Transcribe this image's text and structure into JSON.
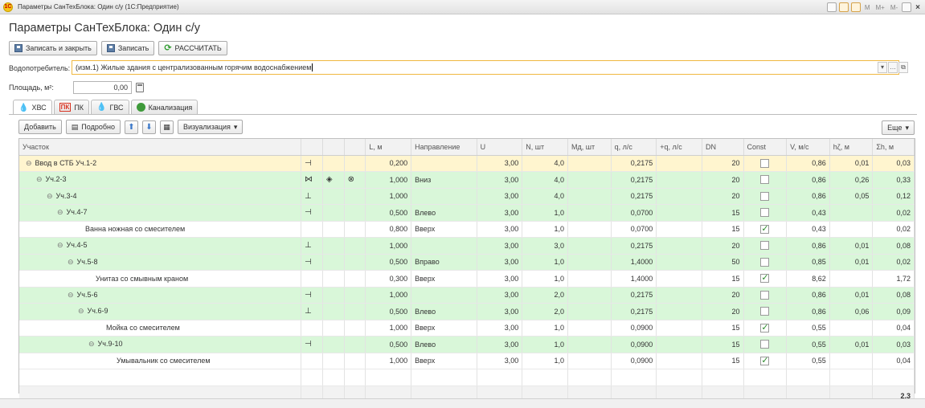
{
  "window": {
    "title": "Параметры СанТехБлока: Один с/у  (1С:Предприятие)",
    "logo": "1C",
    "controls": [
      "M",
      "M+",
      "M-"
    ],
    "close": "×"
  },
  "page_title": "Параметры СанТехБлока: Один с/у",
  "toolbar": {
    "save_close": "Записать и закрыть",
    "save": "Записать",
    "calculate": "РАССЧИТАТЬ"
  },
  "consumer": {
    "label": "Водопотребитель:",
    "value": "(изм.1) Жилые здания с централизованным горячим водоснабжением"
  },
  "area": {
    "label": "Площадь, м²:",
    "value": "0,00"
  },
  "tabs": [
    {
      "label": "ХВС",
      "active": true
    },
    {
      "label": "ПК",
      "badge": "ПК"
    },
    {
      "label": "ГВС"
    },
    {
      "label": "Канализация"
    }
  ],
  "table_toolbar": {
    "add": "Добавить",
    "details": "Подробно",
    "visualization": "Визуализация",
    "more": "Еще"
  },
  "columns": [
    "Участок",
    "",
    "",
    "",
    "L, м",
    "Направление",
    "U",
    "N, шт",
    "Mд, шт",
    "q, л/с",
    "+q, л/с",
    "DN",
    "Const",
    "V, м/с",
    "hζ, м",
    "Σh, м"
  ],
  "rows": [
    {
      "kind": "root",
      "indent": 0,
      "expand": "⊖",
      "name": "Ввод в СТБ Уч.1-2",
      "s1": "⊣",
      "s2": "",
      "s3": "",
      "L": "0,200",
      "dir": "",
      "U": "3,00",
      "N": "4,0",
      "Md": "",
      "q": "0,2175",
      "qplus": "",
      "DN": "20",
      "const": false,
      "V": "0,86",
      "hz": "0,01",
      "sh": "0,03"
    },
    {
      "kind": "seg",
      "indent": 1,
      "expand": "⊖",
      "name": "Уч.2-3",
      "s1": "⋈",
      "s2": "◈",
      "s3": "⊗",
      "L": "1,000",
      "dir": "Вниз",
      "U": "3,00",
      "N": "4,0",
      "Md": "",
      "q": "0,2175",
      "qplus": "",
      "DN": "20",
      "const": false,
      "V": "0,86",
      "hz": "0,26",
      "sh": "0,33"
    },
    {
      "kind": "seg",
      "indent": 2,
      "expand": "⊖",
      "name": "Уч.3-4",
      "s1": "⊥",
      "s2": "",
      "s3": "",
      "L": "1,000",
      "dir": "",
      "U": "3,00",
      "N": "4,0",
      "Md": "",
      "q": "0,2175",
      "qplus": "",
      "DN": "20",
      "const": false,
      "V": "0,86",
      "hz": "0,05",
      "sh": "0,12"
    },
    {
      "kind": "seg",
      "indent": 3,
      "expand": "⊖",
      "name": "Уч.4-7",
      "s1": "⊣",
      "s2": "",
      "s3": "",
      "L": "0,500",
      "dir": "Влево",
      "U": "3,00",
      "N": "1,0",
      "Md": "",
      "q": "0,0700",
      "qplus": "",
      "DN": "15",
      "const": false,
      "V": "0,43",
      "hz": "",
      "sh": "0,02"
    },
    {
      "kind": "dev",
      "indent": 4,
      "expand": "",
      "name": "Ванна ножная со смесителем",
      "s1": "",
      "s2": "",
      "s3": "",
      "L": "0,800",
      "dir": "Вверх",
      "U": "3,00",
      "N": "1,0",
      "Md": "",
      "q": "0,0700",
      "qplus": "",
      "DN": "15",
      "const": true,
      "V": "0,43",
      "hz": "",
      "sh": "0,02"
    },
    {
      "kind": "seg",
      "indent": 3,
      "expand": "⊖",
      "name": "Уч.4-5",
      "s1": "⊥",
      "s2": "",
      "s3": "",
      "L": "1,000",
      "dir": "",
      "U": "3,00",
      "N": "3,0",
      "Md": "",
      "q": "0,2175",
      "qplus": "",
      "DN": "20",
      "const": false,
      "V": "0,86",
      "hz": "0,01",
      "sh": "0,08"
    },
    {
      "kind": "seg",
      "indent": 4,
      "expand": "⊖",
      "name": "Уч.5-8",
      "s1": "⊣",
      "s2": "",
      "s3": "",
      "L": "0,500",
      "dir": "Вправо",
      "U": "3,00",
      "N": "1,0",
      "Md": "",
      "q": "1,4000",
      "qplus": "",
      "DN": "50",
      "const": false,
      "V": "0,85",
      "hz": "0,01",
      "sh": "0,02"
    },
    {
      "kind": "dev",
      "indent": 5,
      "expand": "",
      "name": "Унитаз со смывным краном",
      "s1": "",
      "s2": "",
      "s3": "",
      "L": "0,300",
      "dir": "Вверх",
      "U": "3,00",
      "N": "1,0",
      "Md": "",
      "q": "1,4000",
      "qplus": "",
      "DN": "15",
      "const": true,
      "V": "8,62",
      "hz": "",
      "sh": "1,72"
    },
    {
      "kind": "seg",
      "indent": 4,
      "expand": "⊖",
      "name": "Уч.5-6",
      "s1": "⊣",
      "s2": "",
      "s3": "",
      "L": "1,000",
      "dir": "",
      "U": "3,00",
      "N": "2,0",
      "Md": "",
      "q": "0,2175",
      "qplus": "",
      "DN": "20",
      "const": false,
      "V": "0,86",
      "hz": "0,01",
      "sh": "0,08"
    },
    {
      "kind": "seg",
      "indent": 5,
      "expand": "⊖",
      "name": "Уч.6-9",
      "s1": "⊥",
      "s2": "",
      "s3": "",
      "L": "0,500",
      "dir": "Влево",
      "U": "3,00",
      "N": "2,0",
      "Md": "",
      "q": "0,2175",
      "qplus": "",
      "DN": "20",
      "const": false,
      "V": "0,86",
      "hz": "0,06",
      "sh": "0,09"
    },
    {
      "kind": "dev",
      "indent": 6,
      "expand": "",
      "name": "Мойка со смесителем",
      "s1": "",
      "s2": "",
      "s3": "",
      "L": "1,000",
      "dir": "Вверх",
      "U": "3,00",
      "N": "1,0",
      "Md": "",
      "q": "0,0900",
      "qplus": "",
      "DN": "15",
      "const": true,
      "V": "0,55",
      "hz": "",
      "sh": "0,04"
    },
    {
      "kind": "seg",
      "indent": 6,
      "expand": "⊖",
      "name": "Уч.9-10",
      "s1": "⊣",
      "s2": "",
      "s3": "",
      "L": "0,500",
      "dir": "Влево",
      "U": "3,00",
      "N": "1,0",
      "Md": "",
      "q": "0,0900",
      "qplus": "",
      "DN": "15",
      "const": false,
      "V": "0,55",
      "hz": "0,01",
      "sh": "0,03"
    },
    {
      "kind": "dev",
      "indent": 7,
      "expand": "",
      "name": "Умывальник со смесителем",
      "s1": "",
      "s2": "",
      "s3": "",
      "L": "1,000",
      "dir": "Вверх",
      "U": "3,00",
      "N": "1,0",
      "Md": "",
      "q": "0,0900",
      "qplus": "",
      "DN": "15",
      "const": true,
      "V": "0,55",
      "hz": "",
      "sh": "0,04"
    }
  ],
  "footer": {
    "total_sh": "2,3"
  },
  "colors": {
    "accent_field": "#f0b840",
    "segment_row": "#d9f7d9",
    "root_row": "#fff5cf"
  }
}
